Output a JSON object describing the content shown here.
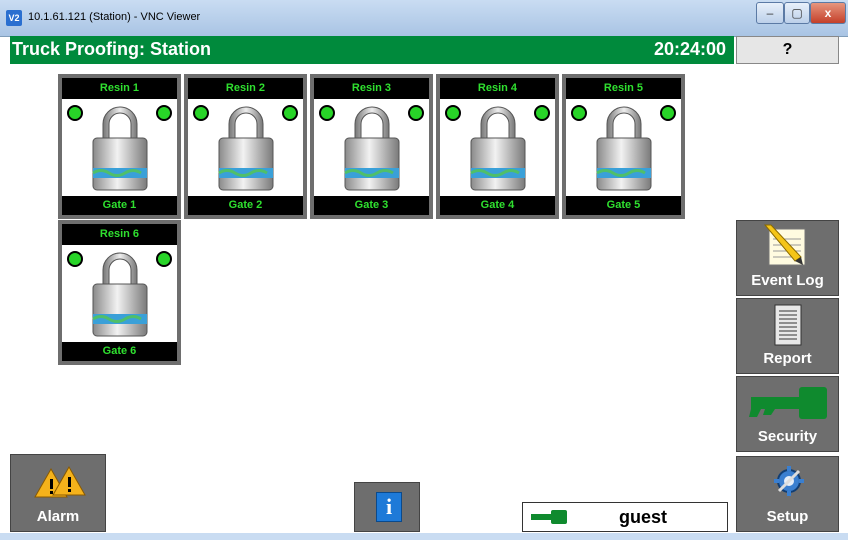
{
  "window": {
    "title": "10.1.61.121 (Station) - VNC Viewer",
    "logo_text": "V2",
    "minimize_glyph": "–",
    "maximize_glyph": "▢",
    "close_glyph": "x"
  },
  "header": {
    "title": "Truck Proofing: Station",
    "time": "20:24:00",
    "help_label": "?",
    "background_color": "#008a3c"
  },
  "gates": [
    {
      "resin": "Resin 1",
      "gate": "Gate 1",
      "status_color": "#28d428"
    },
    {
      "resin": "Resin 2",
      "gate": "Gate 2",
      "status_color": "#28d428"
    },
    {
      "resin": "Resin 3",
      "gate": "Gate 3",
      "status_color": "#28d428"
    },
    {
      "resin": "Resin 4",
      "gate": "Gate 4",
      "status_color": "#28d428"
    },
    {
      "resin": "Resin 5",
      "gate": "Gate 5",
      "status_color": "#28d428"
    },
    {
      "resin": "Resin 6",
      "gate": "Gate 6",
      "status_color": "#28d428"
    }
  ],
  "side_buttons": [
    {
      "label": "Event Log",
      "icon": "notepad-pencil-icon"
    },
    {
      "label": "Report",
      "icon": "document-icon"
    },
    {
      "label": "Security",
      "icon": "key-icon"
    },
    {
      "label": "Setup",
      "icon": "gear-wrench-icon"
    }
  ],
  "bottom": {
    "alarm_label": "Alarm",
    "alarm_icon": "warning-triangles-icon",
    "info_label": "i",
    "info_icon": "info-icon",
    "user_icon": "key-icon",
    "user_name": "guest"
  }
}
